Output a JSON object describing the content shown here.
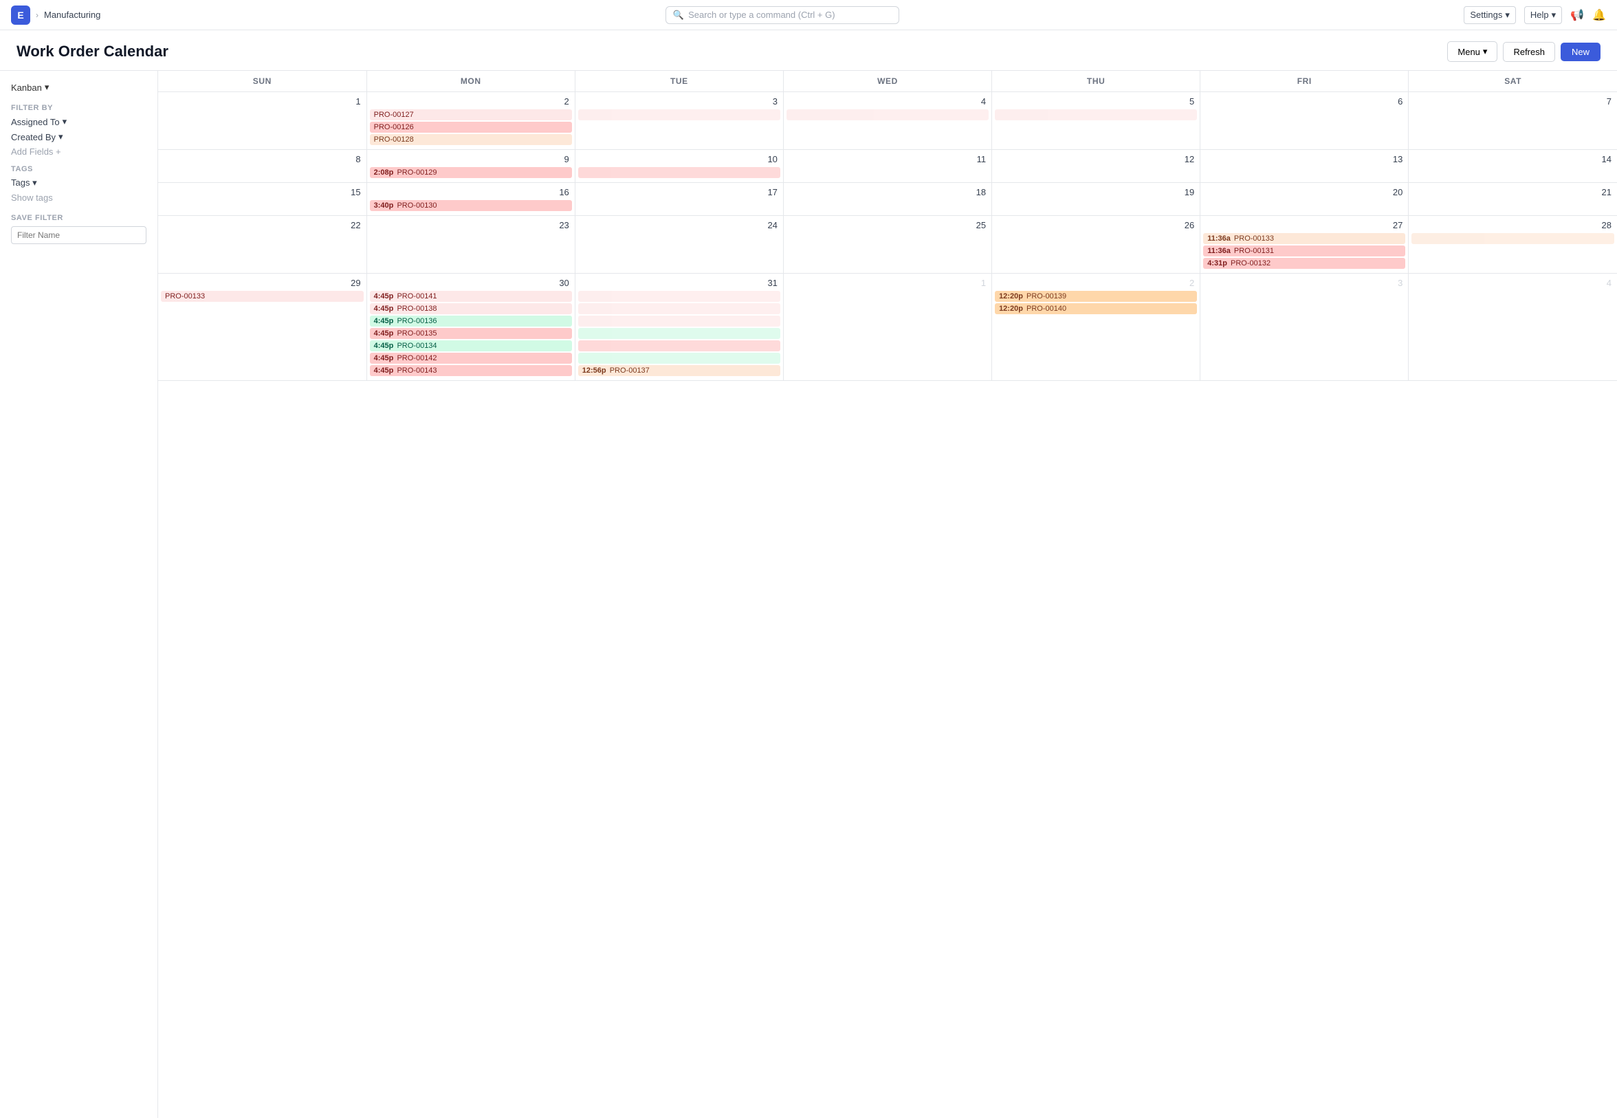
{
  "app": {
    "icon": "E",
    "breadcrumb": "Manufacturing",
    "search_placeholder": "Search or type a command (Ctrl + G)"
  },
  "nav": {
    "settings_label": "Settings",
    "help_label": "Help"
  },
  "header": {
    "title": "Work Order Calendar",
    "menu_label": "Menu",
    "refresh_label": "Refresh",
    "new_label": "New"
  },
  "sidebar": {
    "view_label": "Kanban",
    "filter_by_label": "FILTER BY",
    "assigned_to_label": "Assigned To",
    "created_by_label": "Created By",
    "add_fields_label": "Add Fields +",
    "tags_label": "TAGS",
    "tags_dropdown": "Tags",
    "show_tags_label": "Show tags",
    "save_filter_label": "SAVE FILTER",
    "filter_name_placeholder": "Filter Name"
  },
  "calendar": {
    "days": [
      "SUN",
      "MON",
      "TUE",
      "WED",
      "THU",
      "FRI",
      "SAT"
    ],
    "weeks": [
      {
        "days": [
          {
            "num": "1",
            "muted": false,
            "events": []
          },
          {
            "num": "2",
            "muted": false,
            "events": []
          },
          {
            "num": "3",
            "muted": false,
            "events": []
          },
          {
            "num": "4",
            "muted": false,
            "events": []
          },
          {
            "num": "5",
            "muted": false,
            "events": []
          },
          {
            "num": "6",
            "muted": false,
            "events": []
          },
          {
            "num": "7",
            "muted": false,
            "events": []
          }
        ],
        "spanning": [
          {
            "id": "PRO-00127",
            "start": 1,
            "end": 4,
            "color": "event-light-pink",
            "time": ""
          },
          {
            "id": "PRO-00126",
            "start": 1,
            "end": 1,
            "color": "event-pink",
            "time": ""
          },
          {
            "id": "PRO-00128",
            "start": 1,
            "end": 1,
            "color": "event-peach",
            "time": ""
          }
        ]
      },
      {
        "days": [
          {
            "num": "8",
            "muted": false,
            "events": []
          },
          {
            "num": "9",
            "muted": false,
            "events": [
              {
                "time": "2:08p",
                "id": "PRO-00129",
                "color": "event-pink",
                "span": 1
              }
            ]
          },
          {
            "num": "10",
            "muted": false,
            "events": []
          },
          {
            "num": "11",
            "muted": false,
            "events": []
          },
          {
            "num": "12",
            "muted": false,
            "events": []
          },
          {
            "num": "13",
            "muted": false,
            "events": []
          },
          {
            "num": "14",
            "muted": false,
            "events": []
          }
        ]
      },
      {
        "days": [
          {
            "num": "15",
            "muted": false,
            "events": []
          },
          {
            "num": "16",
            "muted": false,
            "events": [
              {
                "time": "3:40p",
                "id": "PRO-00130",
                "color": "event-pink",
                "span": 0
              }
            ]
          },
          {
            "num": "17",
            "muted": false,
            "events": []
          },
          {
            "num": "18",
            "muted": false,
            "events": []
          },
          {
            "num": "19",
            "muted": false,
            "events": []
          },
          {
            "num": "20",
            "muted": false,
            "events": []
          },
          {
            "num": "21",
            "muted": false,
            "events": []
          }
        ]
      },
      {
        "days": [
          {
            "num": "22",
            "muted": false,
            "events": []
          },
          {
            "num": "23",
            "muted": false,
            "events": []
          },
          {
            "num": "24",
            "muted": false,
            "events": []
          },
          {
            "num": "25",
            "muted": false,
            "events": []
          },
          {
            "num": "26",
            "muted": false,
            "events": []
          },
          {
            "num": "27",
            "muted": false,
            "events": [
              {
                "time": "11:36a",
                "id": "PRO-00133",
                "color": "event-peach",
                "span": 1
              },
              {
                "time": "11:36a",
                "id": "PRO-00131",
                "color": "event-pink",
                "span": 0
              },
              {
                "time": "4:31p",
                "id": "PRO-00132",
                "color": "event-pink",
                "span": 0
              }
            ]
          },
          {
            "num": "28",
            "muted": false,
            "events": []
          }
        ]
      },
      {
        "days": [
          {
            "num": "29",
            "muted": false,
            "events": []
          },
          {
            "num": "30",
            "muted": false,
            "events": [
              {
                "time": "4:45p",
                "id": "PRO-00141",
                "color": "event-light-pink",
                "span": 1
              },
              {
                "time": "4:45p",
                "id": "PRO-00138",
                "color": "event-light-pink",
                "span": 1
              },
              {
                "time": "4:45p",
                "id": "PRO-00136",
                "color": "event-green",
                "span": 1
              },
              {
                "time": "4:45p",
                "id": "PRO-00135",
                "color": "event-pink",
                "span": 1
              },
              {
                "time": "4:45p",
                "id": "PRO-00134",
                "color": "event-green",
                "span": 1
              },
              {
                "time": "4:45p",
                "id": "PRO-00142",
                "color": "event-pink",
                "span": 0
              },
              {
                "time": "4:45p",
                "id": "PRO-00143",
                "color": "event-pink",
                "span": 0
              }
            ]
          },
          {
            "num": "31",
            "muted": false,
            "events": [
              {
                "time": "12:56p",
                "id": "PRO-00137",
                "color": "event-peach",
                "span": 0
              }
            ]
          },
          {
            "num": "1",
            "muted": true,
            "events": []
          },
          {
            "num": "2",
            "muted": true,
            "events": [
              {
                "time": "12:20p",
                "id": "PRO-00139",
                "color": "event-salmon",
                "span": 0
              },
              {
                "time": "12:20p",
                "id": "PRO-00140",
                "color": "event-salmon",
                "span": 0
              }
            ]
          },
          {
            "num": "3",
            "muted": true,
            "events": []
          },
          {
            "num": "4",
            "muted": true,
            "events": []
          }
        ],
        "spanning_row": [
          {
            "id": "PRO-00133",
            "start": 0,
            "end": 2,
            "color": "event-light-pink"
          }
        ]
      }
    ]
  }
}
